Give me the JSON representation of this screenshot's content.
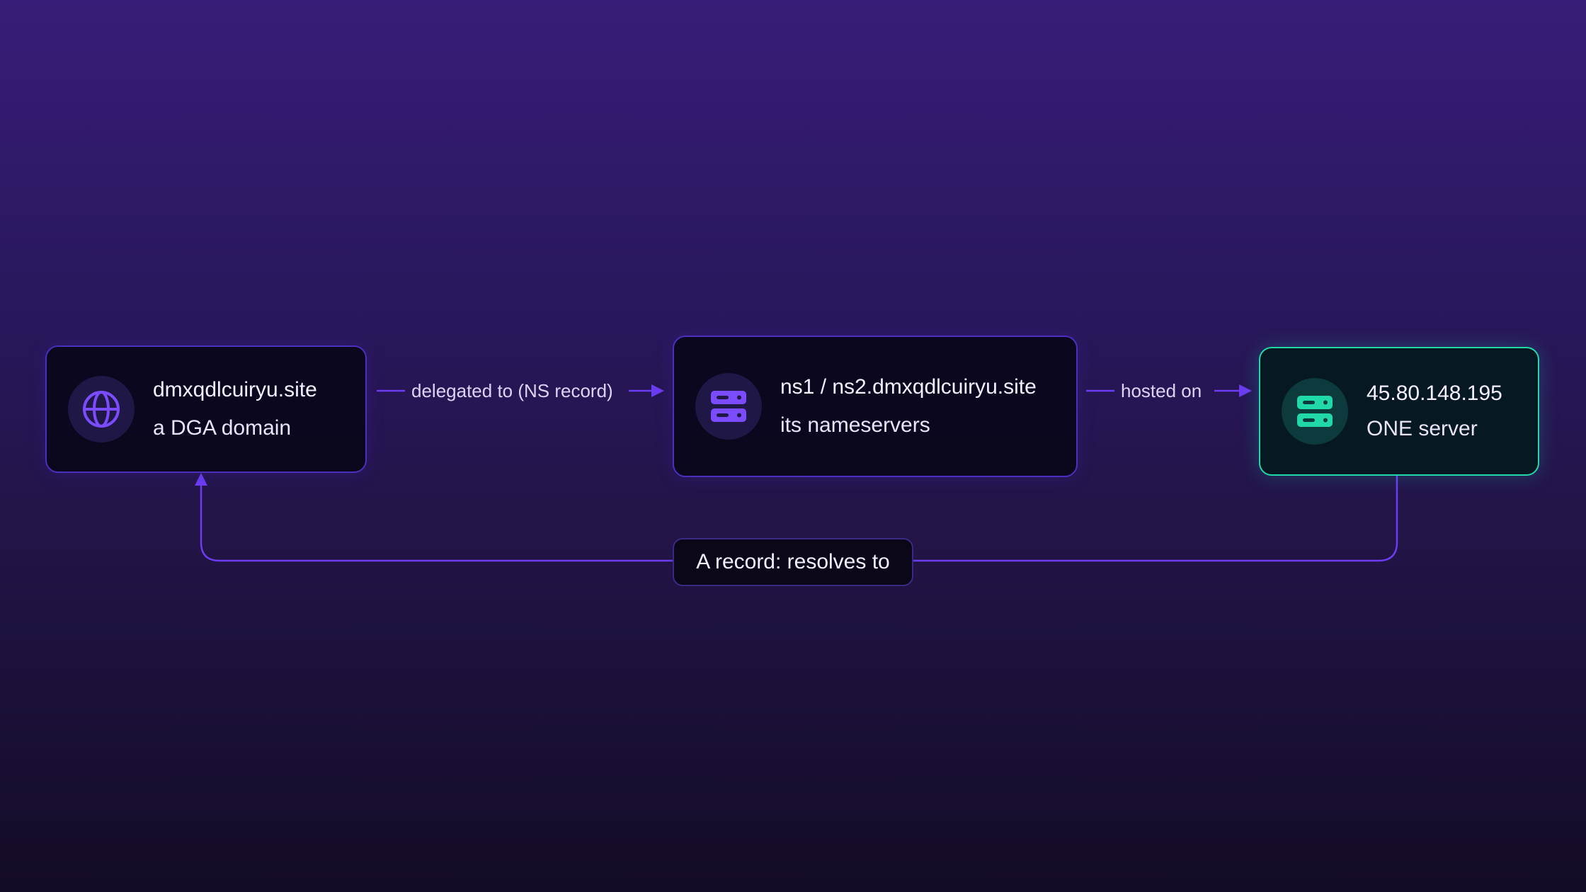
{
  "nodes": {
    "domain": {
      "title": "dmxqdlcuiryu.site",
      "subtitle": "a DGA domain",
      "icon": "globe-icon"
    },
    "nameservers": {
      "title": "ns1 / ns2.dmxqdlcuiryu.site",
      "subtitle": "its nameservers",
      "icon": "server-icon"
    },
    "server": {
      "title": "45.80.148.195",
      "subtitle": "ONE server",
      "icon": "server-icon"
    }
  },
  "edges": {
    "delegated": "delegated to (NS record)",
    "hosted": "hosted on",
    "resolves": "A record: resolves to"
  },
  "colors": {
    "accent": "#6a3df0",
    "highlight": "#21d9a8",
    "background_top": "#381d78",
    "background_bottom": "#140b26"
  }
}
